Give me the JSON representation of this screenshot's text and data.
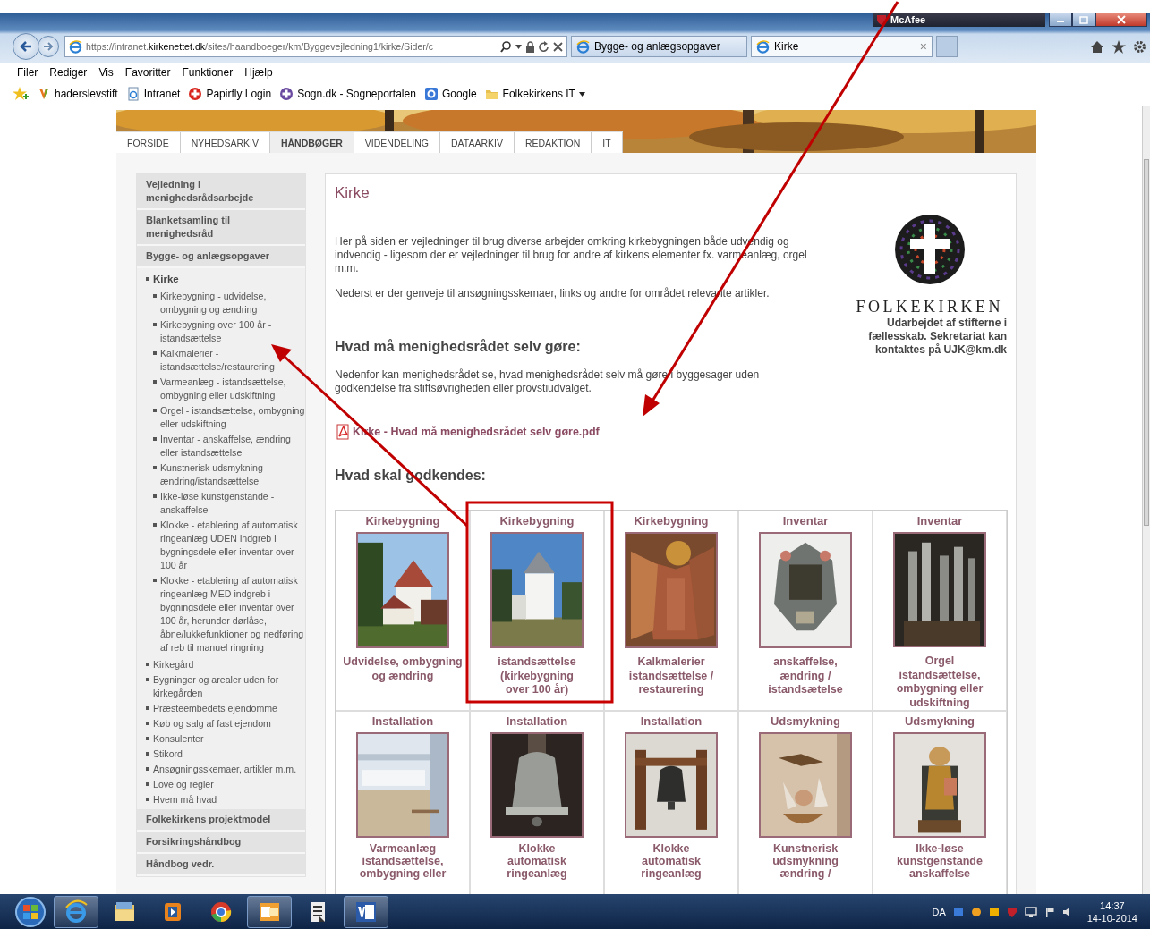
{
  "browser": {
    "security_badge": "McAfee",
    "address": "https://intranet.**kirkenettet.dk**/sites/haandboeger/km/Byggevejledning1/kirke/Sider/c",
    "tabs": [
      {
        "title": "Bygge- og anlægsopgaver",
        "selected": false
      },
      {
        "title": "Kirke",
        "selected": true
      }
    ],
    "tab_close": "×",
    "menu": [
      "Filer",
      "Rediger",
      "Vis",
      "Favoritter",
      "Funktioner",
      "Hjælp"
    ],
    "favorites": [
      {
        "label": "haderslevstift",
        "dropdown": false
      },
      {
        "label": "Intranet",
        "dropdown": false
      },
      {
        "label": "Papirfly Login",
        "dropdown": false
      },
      {
        "label": "Sogn.dk - Sogneportalen",
        "dropdown": false
      },
      {
        "label": "Google",
        "dropdown": false
      },
      {
        "label": "Folkekirkens IT",
        "dropdown": true
      }
    ]
  },
  "page": {
    "nav": [
      {
        "label": "FORSIDE",
        "selected": false
      },
      {
        "label": "NYHEDSARKIV",
        "selected": false
      },
      {
        "label": "HÅNDBØGER",
        "selected": true
      },
      {
        "label": "VIDENDELING",
        "selected": false
      },
      {
        "label": "DATAARKIV",
        "selected": false
      },
      {
        "label": "REDAKTION",
        "selected": false
      },
      {
        "label": "IT",
        "selected": false
      }
    ],
    "sidebar": [
      {
        "label": "Vejledning i menighedsrådsarbejde",
        "selected": false
      },
      {
        "label": "Blanketsamling til menighedsråd",
        "selected": false
      },
      {
        "label": "Bygge- og anlægsopgaver",
        "selected": false,
        "children": [
          {
            "label": "Kirke",
            "selected": true,
            "children": [
              {
                "label": "Kirkebygning - udvidelse, ombygning og ændring",
                "selected": false
              },
              {
                "label": "Kirkebygning over 100 år - istandsættelse",
                "selected": false
              },
              {
                "label": "Kalkmalerier - istandsættelse/restaurering",
                "selected": false
              },
              {
                "label": "Varmeanlæg - istandsættelse, ombygning eller udskiftning",
                "selected": false
              },
              {
                "label": "Orgel - istandsættelse, ombygning eller udskiftning",
                "selected": false
              },
              {
                "label": "Inventar - anskaffelse, ændring eller istandsættelse",
                "selected": false
              },
              {
                "label": "Kunstnerisk udsmykning - ændring/istandsættelse",
                "selected": false
              },
              {
                "label": "Ikke-løse kunstgenstande - anskaffelse",
                "selected": false
              },
              {
                "label": "Klokke - etablering af automatisk ringeanlæg UDEN indgreb i bygningsdele eller inventar over 100 år",
                "selected": false
              },
              {
                "label": "Klokke - etablering af automatisk ringeanlæg MED indgreb i bygningsdele eller inventar over 100 år, herunder dørlåse, åbne/lukkefunktioner og nedføring af reb til manuel ringning",
                "selected": false
              }
            ]
          },
          {
            "label": "Kirkegård",
            "selected": false
          },
          {
            "label": "Bygninger og arealer uden for kirkegården",
            "selected": false
          },
          {
            "label": "Præsteembedets ejendomme",
            "selected": false
          },
          {
            "label": "Køb og salg af fast ejendom",
            "selected": false
          },
          {
            "label": "Konsulenter",
            "selected": false
          },
          {
            "label": "Stikord",
            "selected": false
          },
          {
            "label": "Ansøgningsskemaer, artikler m.m.",
            "selected": false
          },
          {
            "label": "Love og regler",
            "selected": false
          },
          {
            "label": "Hvem må hvad",
            "selected": false
          }
        ]
      },
      {
        "label": "Folkekirkens projektmodel",
        "selected": false
      },
      {
        "label": "Forsikringshåndbog",
        "selected": false
      },
      {
        "label": "Håndbog vedr.",
        "selected": false
      }
    ],
    "main": {
      "title": "Kirke",
      "intro": [
        "Her på siden er vejledninger til brug diverse arbejder omkring kirkebygningen både udvendig og indvendig - ligesom der er vejledninger til brug for andre af kirkens elementer fx. varmeanlæg, orgel m.m.",
        "Nederst er der genveje til ansøgningsskemaer, links og andre for området relevante artikler."
      ],
      "logo_text": "FOLKEKIRKEN",
      "logo_note": "Udarbejdet af stifterne i fællesskab. Sekretariat kan kontaktes på UJK@km.dk",
      "section1": {
        "heading": "Hvad må menighedsrådet selv gøre:",
        "text": "Nedenfor kan menighedsrådet se, hvad menighedsrådet selv må gøre i byggesager uden godkendelse fra stiftsøvrigheden eller provstiudvalget.",
        "pdf_link": "Kirke - Hvad må menighedsrådet selv gøre.pdf"
      },
      "section2": {
        "heading": "Hvad skal godkendes:"
      },
      "cards": [
        {
          "category": "Kirkebygning",
          "caption": "Udvidelse, ombygning\nog ændring"
        },
        {
          "category": "Kirkebygning",
          "caption": "istandsættelse\n(kirkebygning\nover 100 år)"
        },
        {
          "category": "Kirkebygning",
          "caption": "Kalkmalerier\nistandsættelse /\nrestaurering"
        },
        {
          "category": "Inventar",
          "caption": "anskaffelse,\nændring /\nistandsætelse"
        },
        {
          "category": "Inventar",
          "caption": "Orgel\nistandsættelse,\nombygning eller\nudskiftning"
        },
        {
          "category": "Installation",
          "caption": "Varmeanlæg\nistandsættelse,\nombygning eller"
        },
        {
          "category": "Installation",
          "caption": "Klokke\nautomatisk\nringeanlæg"
        },
        {
          "category": "Installation",
          "caption": "Klokke\nautomatisk\nringeanlæg"
        },
        {
          "category": "Udsmykning",
          "caption": "Kunstnerisk\nudsmykning\nændring /"
        },
        {
          "category": "Udsmykning",
          "caption": "Ikke-løse\nkunstgenstande\nanskaffelse"
        }
      ]
    }
  },
  "taskbar": {
    "buttons": [
      {
        "running": true
      },
      {
        "running": false
      },
      {
        "running": false
      },
      {
        "running": false
      },
      {
        "running": true
      },
      {
        "running": false
      },
      {
        "running": true
      }
    ],
    "language": "DA",
    "time": "14:37",
    "date": "14-10-2014"
  }
}
